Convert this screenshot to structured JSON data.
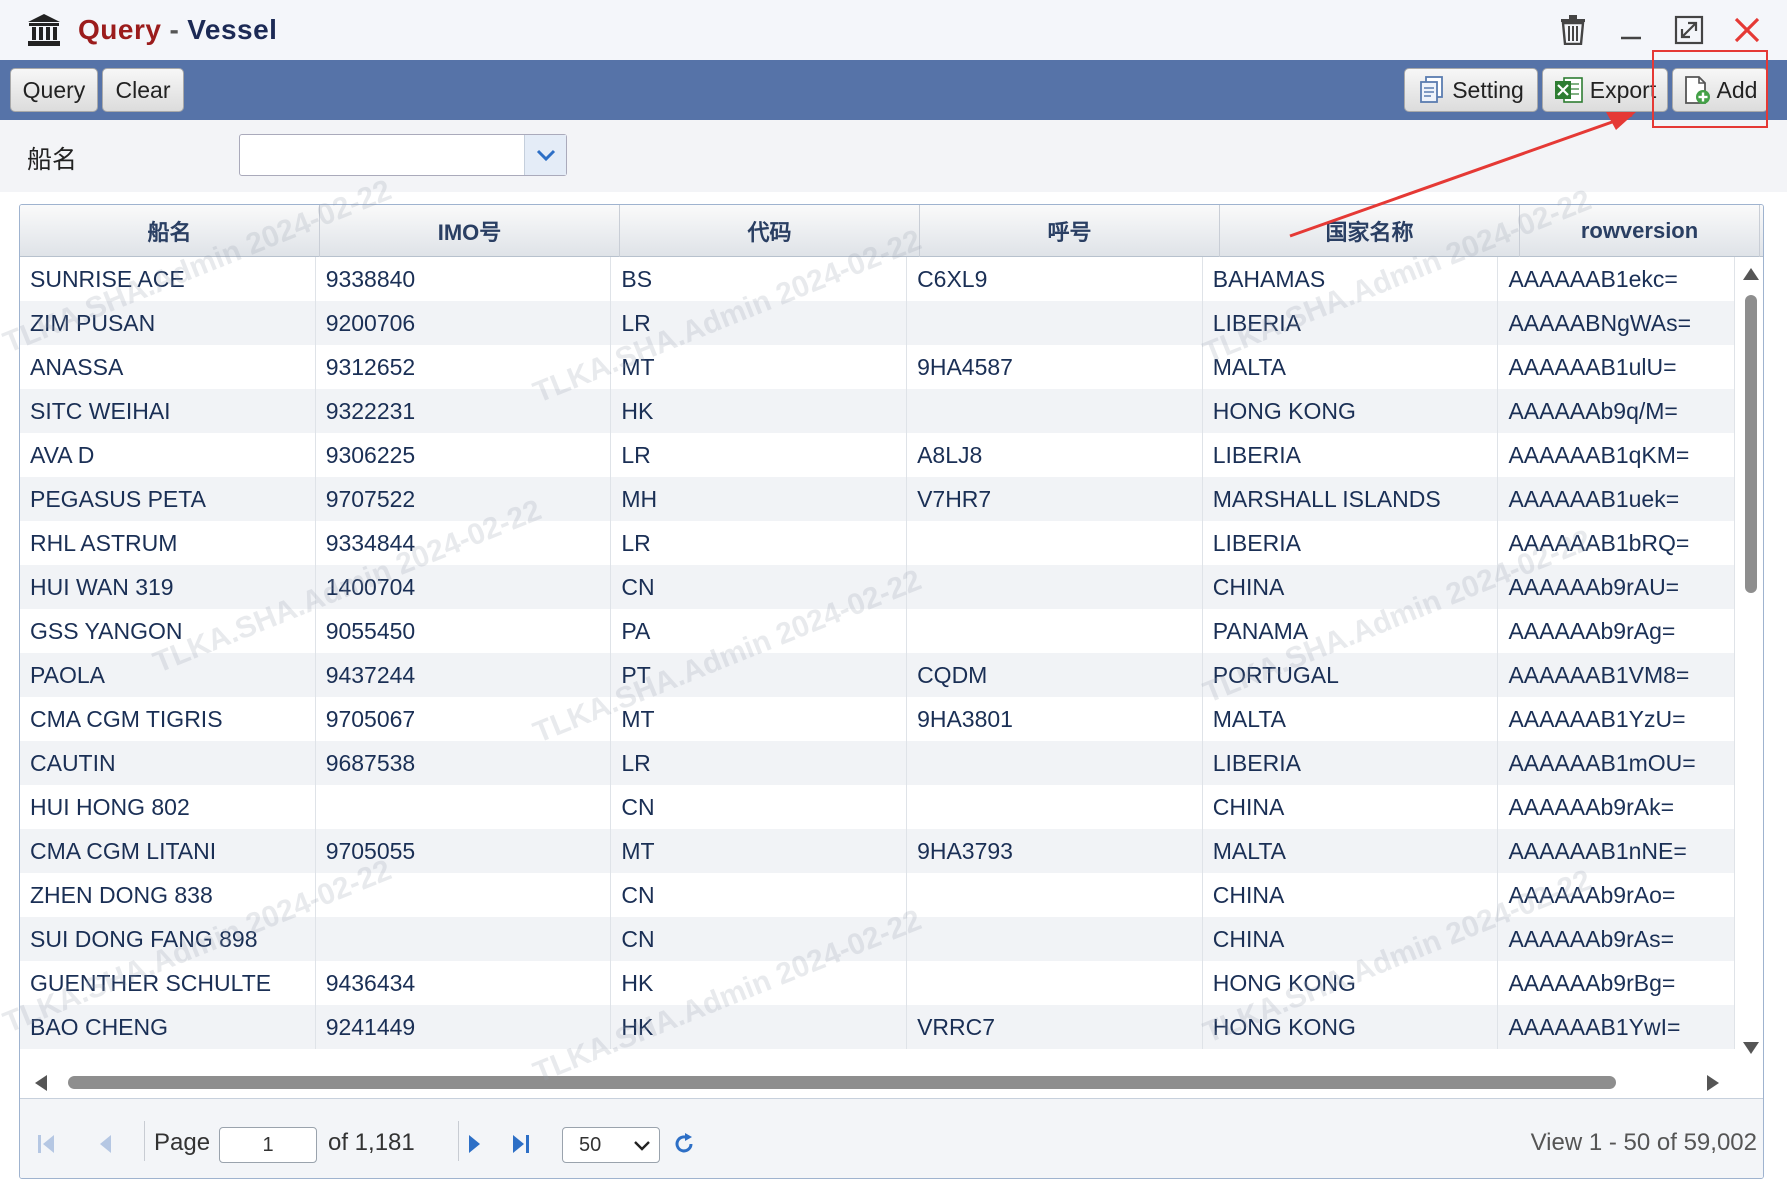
{
  "window": {
    "title_part1": "Query",
    "title_separator": "-",
    "title_part2": "Vessel"
  },
  "toolbar": {
    "query_label": "Query",
    "clear_label": "Clear",
    "setting_label": "Setting",
    "export_label": "Export",
    "add_label": "Add"
  },
  "filter": {
    "label": "船名",
    "value": ""
  },
  "grid": {
    "columns": [
      "船名",
      "IMO号",
      "代码",
      "呼号",
      "国家名称",
      "rowversion"
    ],
    "rows": [
      [
        "SUNRISE ACE",
        "9338840",
        "BS",
        "C6XL9",
        "BAHAMAS",
        "AAAAAAB1ekc="
      ],
      [
        "ZIM PUSAN",
        "9200706",
        "LR",
        "",
        "LIBERIA",
        "AAAAABNgWAs="
      ],
      [
        "ANASSA",
        "9312652",
        "MT",
        "9HA4587",
        "MALTA",
        "AAAAAAB1ulU="
      ],
      [
        "SITC WEIHAI",
        "9322231",
        "HK",
        "",
        "HONG KONG",
        "AAAAAAb9q/M="
      ],
      [
        "AVA D",
        "9306225",
        "LR",
        "A8LJ8",
        "LIBERIA",
        "AAAAAAB1qKM="
      ],
      [
        "PEGASUS PETA",
        "9707522",
        "MH",
        "V7HR7",
        "MARSHALL ISLANDS",
        "AAAAAAB1uek="
      ],
      [
        "RHL ASTRUM",
        "9334844",
        "LR",
        "",
        "LIBERIA",
        "AAAAAAB1bRQ="
      ],
      [
        "HUI WAN 319",
        "1400704",
        "CN",
        "",
        "CHINA",
        "AAAAAAb9rAU="
      ],
      [
        "GSS YANGON",
        "9055450",
        "PA",
        "",
        "PANAMA",
        "AAAAAAb9rAg="
      ],
      [
        "PAOLA",
        "9437244",
        "PT",
        "CQDM",
        "PORTUGAL",
        "AAAAAAB1VM8="
      ],
      [
        "CMA CGM TIGRIS",
        "9705067",
        "MT",
        "9HA3801",
        "MALTA",
        "AAAAAAB1YzU="
      ],
      [
        "CAUTIN",
        "9687538",
        "LR",
        "",
        "LIBERIA",
        "AAAAAAB1mOU="
      ],
      [
        "HUI HONG 802",
        "",
        "CN",
        "",
        "CHINA",
        "AAAAAAb9rAk="
      ],
      [
        "CMA CGM LITANI",
        "9705055",
        "MT",
        "9HA3793",
        "MALTA",
        "AAAAAAB1nNE="
      ],
      [
        "ZHEN DONG 838",
        "",
        "CN",
        "",
        "CHINA",
        "AAAAAAb9rAo="
      ],
      [
        "SUI DONG FANG 898",
        "",
        "CN",
        "",
        "CHINA",
        "AAAAAAb9rAs="
      ],
      [
        "GUENTHER SCHULTE",
        "9436434",
        "HK",
        "",
        "HONG KONG",
        "AAAAAAb9rBg="
      ],
      [
        "BAO CHENG",
        "9241449",
        "HK",
        "VRRC7",
        "HONG KONG",
        "AAAAAAB1YwI="
      ]
    ]
  },
  "pager": {
    "page_label": "Page",
    "page_value": "1",
    "of_label": "of 1,181",
    "page_size": "50",
    "view_text": "View 1 - 50 of 59,002"
  },
  "watermark": "TLKA.SHA.Admin 2024-02-22",
  "colors": {
    "toolbar_bg": "#5673a8",
    "title_query": "#9b1c1c",
    "title_vessel": "#1c2a55",
    "highlight": "#e53935"
  },
  "icons": {
    "app": "bank-icon",
    "delete": "trash-icon",
    "minimize": "minimize-icon",
    "maximize": "maximize-icon",
    "close": "close-icon"
  }
}
